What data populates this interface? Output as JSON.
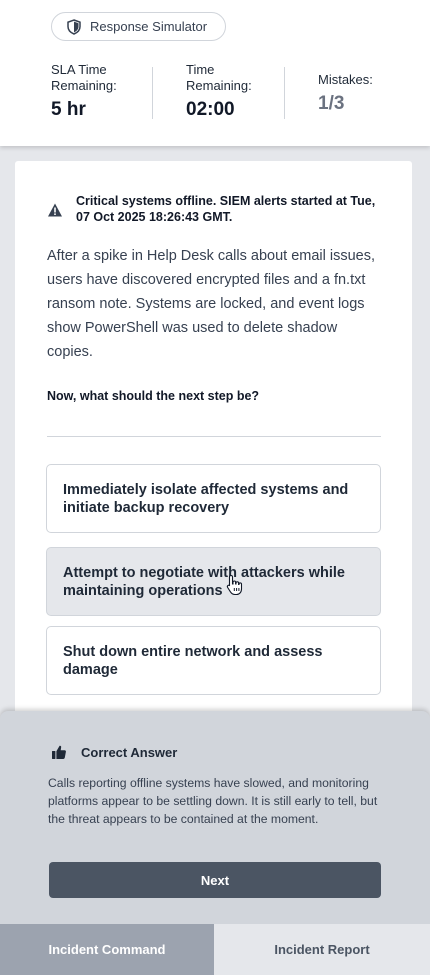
{
  "header": {
    "badge_label": "Response Simulator",
    "stats": [
      {
        "label": "SLA Time Remaining:",
        "value": "5 hr"
      },
      {
        "label": "Time Remaining:",
        "value": "02:00"
      },
      {
        "label": "Mistakes:",
        "value": "1/3"
      }
    ]
  },
  "scenario": {
    "alert": "Critical systems offline. SIEM alerts started at Tue, 07 Oct 2025 18:26:43 GMT.",
    "description": "After a spike in Help Desk calls about email issues, users have discovered encrypted files and a fn.txt ransom note. Systems are locked, and event logs show PowerShell was used to delete shadow copies.",
    "prompt": "Now, what should the next step be?"
  },
  "options": [
    "Immediately isolate affected systems and initiate backup recovery",
    "Attempt to negotiate with attackers while maintaining operations",
    "Shut down entire network and assess damage"
  ],
  "feedback": {
    "title": "Correct Answer",
    "body": "Calls reporting offline systems have slowed, and monitoring platforms appear to be settling down. It is still early to tell, but the threat appears to be contained at the moment.",
    "next_label": "Next"
  },
  "tabs": [
    "Incident Command",
    "Incident Report"
  ],
  "icons": {
    "badge": "shield-icon",
    "alert": "warning-icon",
    "feedback": "thumbs-up-icon",
    "cursor": "hand-pointer-icon"
  }
}
